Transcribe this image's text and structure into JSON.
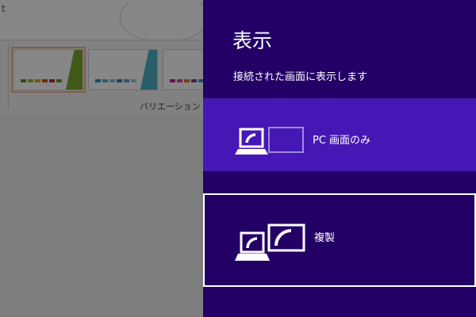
{
  "background_app": {
    "title_fragment": "t",
    "ribbon_group_label": "バリエーション",
    "variations": [
      {
        "stripe_color": "#7dab2e",
        "dot_colors": [
          "#5e8f1f",
          "#8fbf2f",
          "#d6a21a",
          "#c9561c",
          "#b7282e",
          "#6d9b2c"
        ],
        "selected": true
      },
      {
        "stripe_color": "#4fb2c7",
        "dot_colors": [
          "#2f8fb0",
          "#4fb2c7",
          "#7dc7d6",
          "#3d7fa8",
          "#5aa0b8",
          "#8ad0d8"
        ],
        "selected": false
      },
      {
        "stripe_color": "#d8439a",
        "dot_colors": [
          "#b02c7c",
          "#d8439a",
          "#e46e28",
          "#7c3fa0",
          "#4b8fc8",
          "#8c8c8c"
        ],
        "selected": false
      }
    ]
  },
  "project_pane": {
    "title": "表示",
    "subtitle": "接続された画面に表示します",
    "colors": {
      "background": "#230066",
      "highlight": "#4617b4",
      "selection_border": "#ffffff"
    },
    "options": [
      {
        "label": "PC 画面のみ",
        "icon": "pc-screen-only-icon",
        "state": "hover"
      },
      {
        "label": "複製",
        "icon": "duplicate-icon",
        "state": "selected"
      }
    ]
  }
}
